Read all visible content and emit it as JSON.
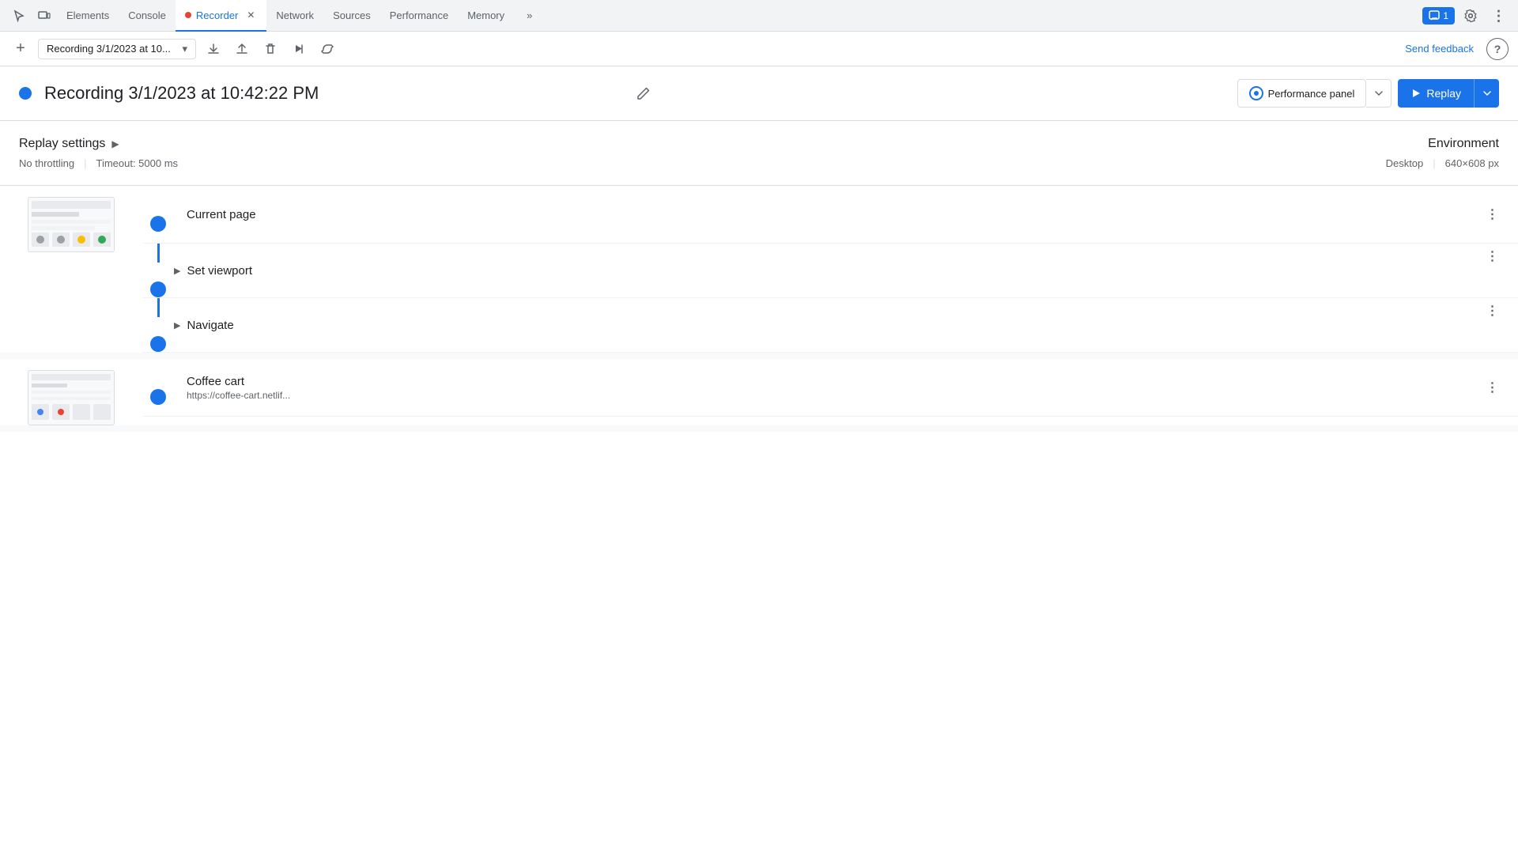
{
  "tabs": {
    "items": [
      {
        "label": "Elements",
        "active": false
      },
      {
        "label": "Console",
        "active": false
      },
      {
        "label": "Recorder",
        "active": true
      },
      {
        "label": "Network",
        "active": false
      },
      {
        "label": "Sources",
        "active": false
      },
      {
        "label": "Performance",
        "active": false
      },
      {
        "label": "Memory",
        "active": false
      }
    ],
    "more_label": "»",
    "badge": "1",
    "gear_label": "⚙",
    "menu_label": "⋮"
  },
  "toolbar": {
    "add_label": "+",
    "recording_name": "Recording 3/1/2023 at 10...",
    "dropdown_arrow": "▾",
    "export_label": "↑",
    "import_label": "↓",
    "delete_label": "🗑",
    "play_label": "▷",
    "loop_label": "↺",
    "send_feedback_label": "Send feedback",
    "help_label": "?"
  },
  "recording": {
    "title": "Recording 3/1/2023 at 10:42:22 PM",
    "dot_color": "#1a73e8"
  },
  "buttons": {
    "performance_panel": "Performance panel",
    "replay": "Replay"
  },
  "replay_settings": {
    "title": "Replay settings",
    "throttle": "No throttling",
    "pipe": "|",
    "timeout": "Timeout: 5000 ms",
    "env_title": "Environment",
    "env_type": "Desktop",
    "env_pipe": "|",
    "env_size": "640×608 px"
  },
  "steps": {
    "group1": {
      "title": "Current page",
      "steps": [
        {
          "label": "Set viewport",
          "has_chevron": true
        },
        {
          "label": "Navigate",
          "has_chevron": true
        }
      ]
    },
    "group2": {
      "title": "Coffee cart",
      "url": "https://coffee-cart.netlif..."
    }
  },
  "colors": {
    "blue": "#1a73e8",
    "border": "#dadce0",
    "bg_light": "#f8f9fa",
    "text_primary": "#202124",
    "text_secondary": "#5f6368"
  }
}
